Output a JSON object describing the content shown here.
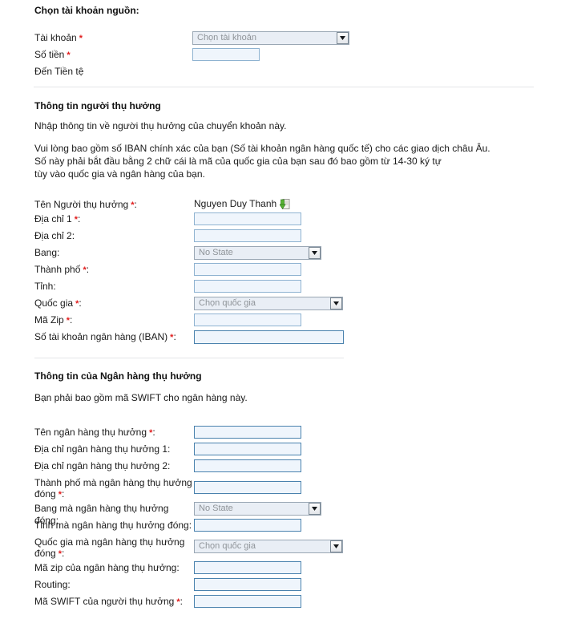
{
  "source_section": {
    "title": "Chọn tài khoản nguồn:",
    "fields": [
      {
        "label": "Tài khoản",
        "required": true,
        "control": "select",
        "value": "Chọn tài khoản"
      },
      {
        "label": "Số tiền",
        "required": true,
        "control": "text",
        "value": ""
      },
      {
        "label": "Đến Tiền tệ",
        "required": false,
        "control": "none",
        "value": ""
      }
    ]
  },
  "beneficiary_section": {
    "title": "Thông tin người thụ hưởng",
    "intro": "Nhập thông tin về người thụ hưởng của chuyển khoản này.",
    "note_lines": [
      "Vui lòng bao gồm số IBAN chính xác của bạn (Số tài khoản ngân hàng quốc tế) cho các giao dịch châu Âu.",
      "Số này phải bắt đầu bằng 2 chữ cái là mã của quốc gia của bạn sau đó bao gồm từ 14-30 ký tự",
      "tùy vào quốc gia và ngân hàng của bạn."
    ],
    "fields": [
      {
        "label": "Tên Người thụ hưởng",
        "required": true,
        "control": "static",
        "value": "Nguyen Duy Thanh",
        "icon": "import-contact-icon"
      },
      {
        "label": "Địa chỉ 1",
        "required": true,
        "control": "text",
        "value": ""
      },
      {
        "label": "Địa chỉ 2",
        "required": false,
        "control": "text",
        "value": ""
      },
      {
        "label": "Bang",
        "required": false,
        "control": "select",
        "value": "No State"
      },
      {
        "label": "Thành phố",
        "required": true,
        "control": "text",
        "value": ""
      },
      {
        "label": "Tỉnh",
        "required": false,
        "control": "text",
        "value": ""
      },
      {
        "label": "Quốc gia",
        "required": true,
        "control": "select",
        "value": "Chọn quốc gia"
      },
      {
        "label": "Mã Zip",
        "required": true,
        "control": "text",
        "value": ""
      },
      {
        "label": "Số tài khoản ngân hàng (IBAN)",
        "required": true,
        "control": "text",
        "value": ""
      }
    ]
  },
  "bank_section": {
    "title": "Thông tin của Ngân hàng thụ hưởng",
    "intro": "Bạn phải bao gồm mã SWIFT cho ngân hàng này.",
    "fields": [
      {
        "label": "Tên ngân hàng thụ hưởng",
        "required": true,
        "control": "text",
        "value": ""
      },
      {
        "label": "Địa chỉ ngân hàng thụ hưởng 1",
        "required": false,
        "control": "text",
        "value": ""
      },
      {
        "label": "Địa chỉ ngân hàng thụ hưởng 2",
        "required": false,
        "control": "text",
        "value": ""
      },
      {
        "label": "Thành phố mà ngân hàng thụ hưởng đóng",
        "required": true,
        "control": "text",
        "value": ""
      },
      {
        "label": "Bang mà ngân hàng thụ hưởng đóng",
        "required": false,
        "control": "select",
        "value": "No State"
      },
      {
        "label": "Tỉnh mà ngân hàng thụ hưởng đóng",
        "required": false,
        "control": "text",
        "value": ""
      },
      {
        "label": "Quốc gia mà ngân hàng thụ hưởng đóng",
        "required": true,
        "control": "select",
        "value": "Chọn quốc gia"
      },
      {
        "label": "Mã zip của ngân hàng thụ hưởng",
        "required": false,
        "control": "text",
        "value": ""
      },
      {
        "label": "Routing",
        "required": false,
        "control": "text",
        "value": ""
      },
      {
        "label": "Mã SWIFT của người thụ hưởng",
        "required": true,
        "control": "text",
        "value": ""
      }
    ]
  },
  "colors": {
    "required_asterisk": "#e01b1b",
    "input_fill": "#eff5fc",
    "input_border": "#6e9cc4",
    "select_fill": "#e9eef5",
    "select_border": "#9aa7b4",
    "placeholder_text": "#8f9499",
    "divider": "#e4e6e8",
    "icon_green": "#3c9f3c"
  }
}
